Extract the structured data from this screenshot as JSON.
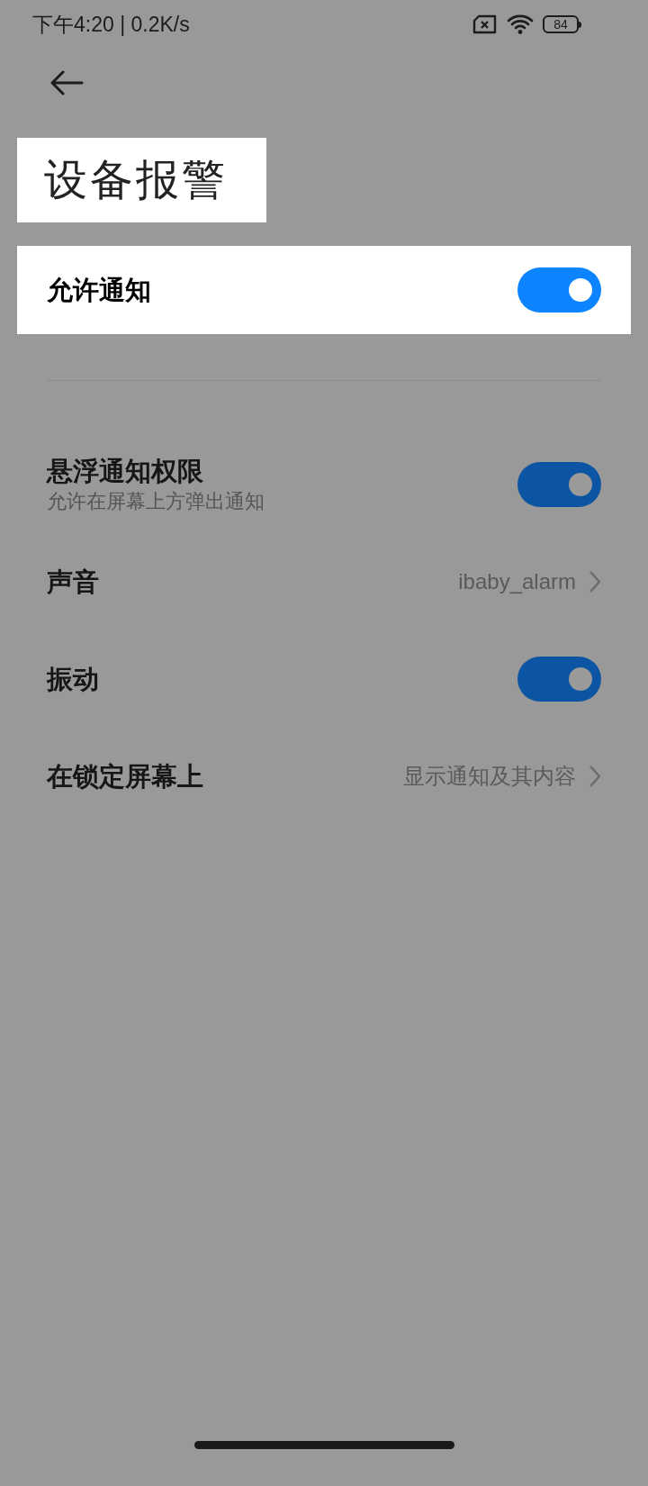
{
  "status_bar": {
    "time": "下午4:20 | 0.2K/s",
    "battery": "84"
  },
  "title": {
    "text": "设备报警",
    "highlighted": true
  },
  "rows": [
    {
      "kind": "toggle",
      "label": "允许通知",
      "on": true,
      "highlighted": true
    },
    {
      "kind": "divider"
    },
    {
      "kind": "toggle",
      "label": "悬浮通知权限",
      "subtitle": "允许在屏幕上方弹出通知",
      "on": true,
      "highlighted": false
    },
    {
      "kind": "link",
      "label": "声音",
      "value": "ibaby_alarm",
      "highlighted": false
    },
    {
      "kind": "toggle",
      "label": "振动",
      "on": true,
      "highlighted": false
    },
    {
      "kind": "link",
      "label": "在锁定屏幕上",
      "value": "显示通知及其内容",
      "highlighted": false
    }
  ]
}
